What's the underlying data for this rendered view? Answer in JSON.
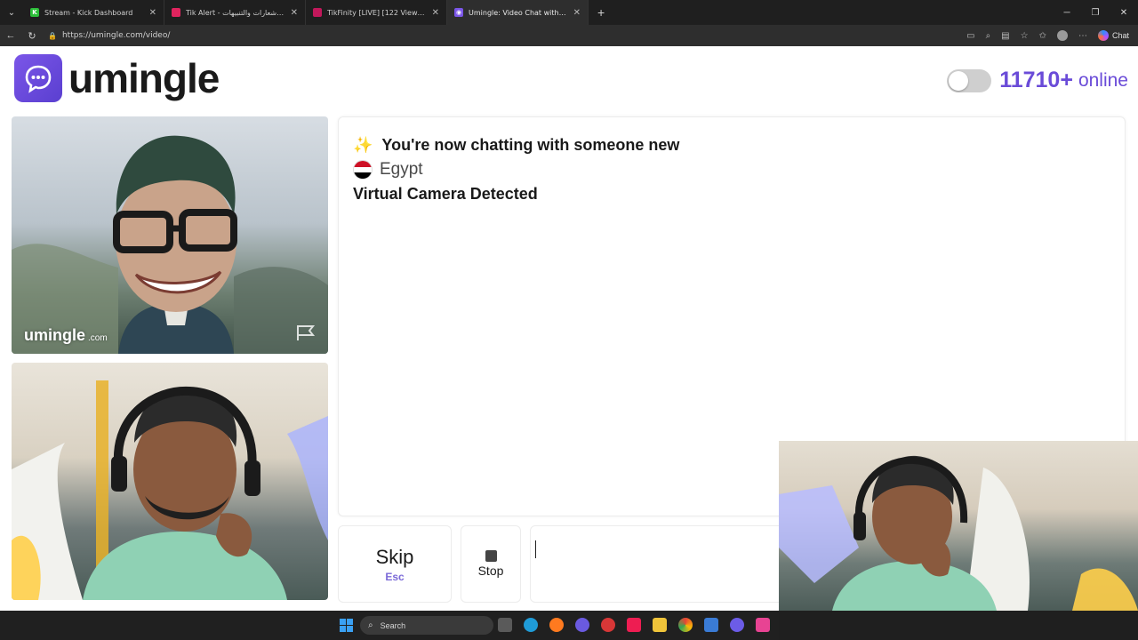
{
  "browser": {
    "tabs": [
      {
        "title": "Stream - Kick Dashboard",
        "favicon_color": "#2dbf3a",
        "active": false
      },
      {
        "title": "Tik Alert - منصة الإشعارات والتنبيهات",
        "favicon_color": "#e0245e",
        "active": false
      },
      {
        "title": "TikFinity [LIVE] [122 Viewers]",
        "favicon_color": "#c2185b",
        "active": false
      },
      {
        "title": "Umingle: Video Chat with Str",
        "favicon_color": "#7b56e8",
        "active": true
      }
    ],
    "new_tab": "+",
    "url": "https://umingle.com/video/",
    "copilot_label": "Chat"
  },
  "site": {
    "logo_text": "umingle",
    "online_count": "11710+",
    "online_label": "online",
    "accent_color": "#6a4bd8"
  },
  "video": {
    "watermark": "umingle",
    "watermark_suffix": ".com"
  },
  "chat": {
    "line1_icon": "✨",
    "line1": "You're now chatting with someone new",
    "country": "Egypt",
    "line3": "Virtual Camera Detected"
  },
  "controls": {
    "skip_label": "Skip",
    "skip_shortcut": "Esc",
    "stop_label": "Stop",
    "message_value": ""
  },
  "taskbar": {
    "search_placeholder": "Search"
  }
}
